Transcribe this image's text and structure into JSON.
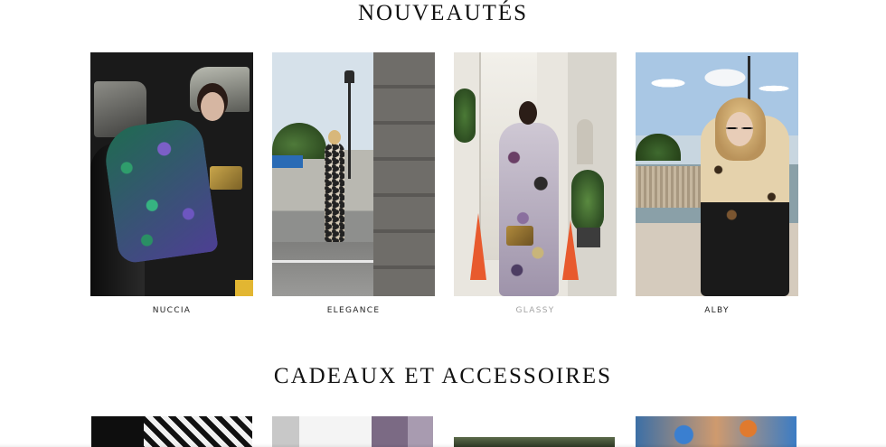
{
  "sections": {
    "new_arrivals_title": "NOUVEAUTÉS",
    "gifts_title": "CADEAUX ET ACCESSOIRES"
  },
  "products": [
    {
      "name": "NUCCIA"
    },
    {
      "name": "ELEGANCE"
    },
    {
      "name": "GLASSY"
    },
    {
      "name": "ALBY"
    }
  ],
  "colors": {
    "title": "#111111",
    "label": "#222222",
    "label_muted": "#a3a3a3",
    "background": "#ffffff"
  }
}
